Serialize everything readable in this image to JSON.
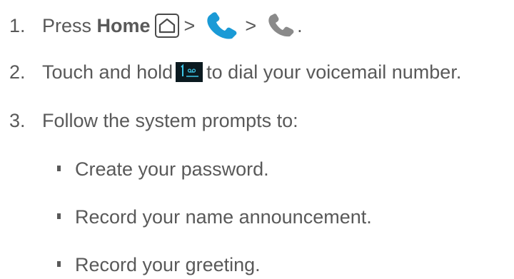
{
  "steps": [
    {
      "number": "1.",
      "text_before": "Press ",
      "bold": "Home",
      "separator": ">",
      "end": "."
    },
    {
      "number": "2.",
      "text_before": "Touch and hold",
      "text_after": "to dial your voicemail number."
    },
    {
      "number": "3.",
      "text": "Follow the system prompts to:"
    }
  ],
  "sub_items": [
    "Create your password.",
    "Record your name announcement.",
    "Record your greeting."
  ],
  "icons": {
    "home": "home-key-icon",
    "phone_app": "phone-app-icon",
    "phone_gray": "phone-icon",
    "voicemail_key": "voicemail-key-icon"
  },
  "colors": {
    "text": "#595959",
    "phone_blue": "#1a9ad6",
    "phone_gray": "#8a8a8a",
    "voicemail_key_bg": "#0b1a20",
    "voicemail_key_glyph": "#3ec8ea"
  }
}
